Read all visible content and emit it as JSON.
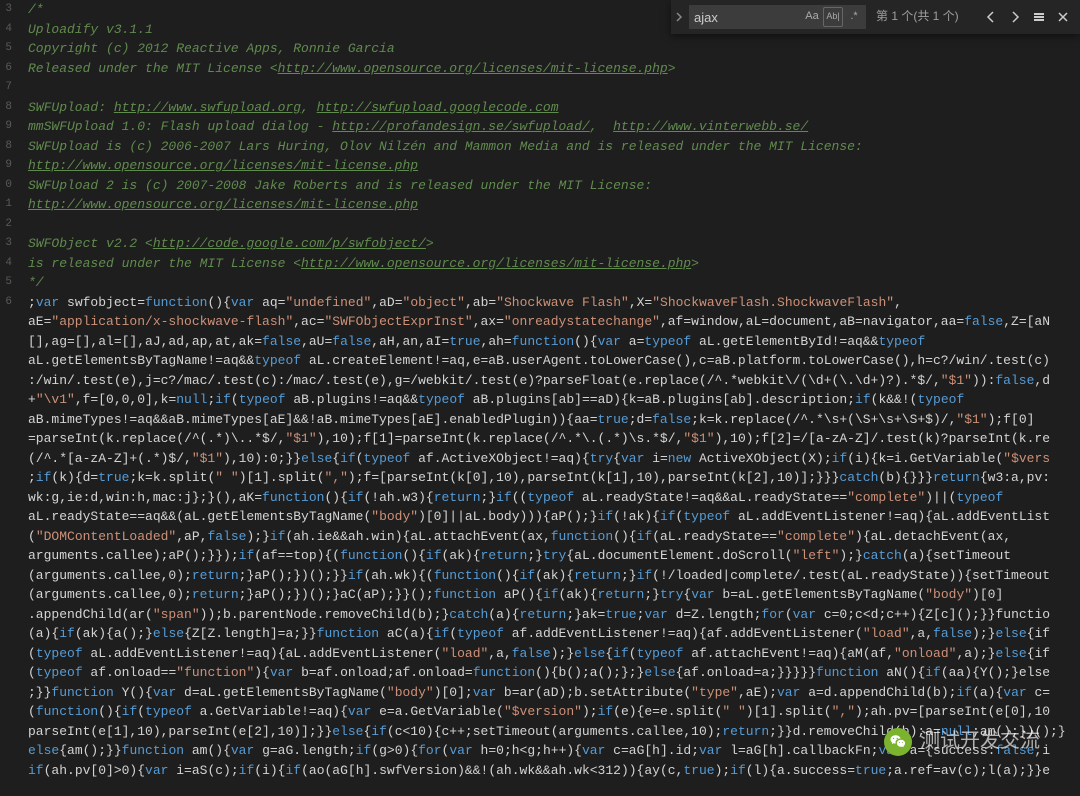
{
  "find_widget": {
    "input_value": "ajax",
    "match_case_label": "Aa",
    "whole_word_label": "Ab|",
    "regex_label": ".*",
    "result_count_text": "第 1 个(共 1 个)"
  },
  "watermark": {
    "text": "测试开发交流"
  },
  "code_lines": [
    {
      "n": "3",
      "t": "/*",
      "cls": "comment"
    },
    {
      "n": "4",
      "t": "Uploadify v3.1.1",
      "cls": "comment"
    },
    {
      "n": "5",
      "t": "Copyright (c) 2012 Reactive Apps, Ronnie Garcia",
      "cls": "comment"
    },
    {
      "n": "6",
      "html": "<span class='comment'>Released under the MIT License &lt;</span><span class='link'>http://www.opensource.org/licenses/mit-license.php</span><span class='comment'>&gt;</span>"
    },
    {
      "n": "7",
      "t": "",
      "cls": "comment"
    },
    {
      "n": "8",
      "html": "<span class='comment'>SWFUpload: </span><span class='link'>http://www.swfupload.org</span><span class='comment'>, </span><span class='link'>http://swfupload.googlecode.com</span>"
    },
    {
      "n": "9",
      "html": "<span class='comment'>mmSWFUpload 1.0: Flash upload dialog - </span><span class='link'>http://profandesign.se/swfupload/</span><span class='comment'>,  </span><span class='link'>http://www.vinterwebb.se/</span>"
    },
    {
      "n": "8",
      "t": "SWFUpload is (c) 2006-2007 Lars Huring, Olov Nilzén and Mammon Media and is released under the MIT License:",
      "cls": "comment"
    },
    {
      "n": "9",
      "html": "<span class='link'>http://www.opensource.org/licenses/mit-license.php</span>"
    },
    {
      "n": "0",
      "t": "SWFUpload 2 is (c) 2007-2008 Jake Roberts and is released under the MIT License:",
      "cls": "comment"
    },
    {
      "n": "1",
      "html": "<span class='link'>http://www.opensource.org/licenses/mit-license.php</span>"
    },
    {
      "n": "2",
      "t": "",
      "cls": "comment"
    },
    {
      "n": "3",
      "html": "<span class='comment'>SWFObject v2.2 &lt;</span><span class='link'>http://code.google.com/p/swfobject/</span><span class='comment'>&gt;</span>"
    },
    {
      "n": "4",
      "html": "<span class='comment'>is released under the MIT License &lt;</span><span class='link'>http://www.opensource.org/licenses/mit-license.php</span><span class='comment'>&gt;</span>"
    },
    {
      "n": "5",
      "t": "*/",
      "cls": "comment"
    },
    {
      "n": "6",
      "html": ";<span class='kw'>var</span> swfobject=<span class='kw'>function</span>(){<span class='kw'>var</span> aq=<span class='str'>\"undefined\"</span>,aD=<span class='str'>\"object\"</span>,ab=<span class='str'>\"Shockwave Flash\"</span>,X=<span class='str'>\"ShockwaveFlash.ShockwaveFlash\"</span>,"
    },
    {
      "n": "",
      "html": "aE=<span class='str'>\"application/x-shockwave-flash\"</span>,ac=<span class='str'>\"SWFObjectExprInst\"</span>,ax=<span class='str'>\"onreadystatechange\"</span>,af=window,aL=document,aB=navigator,aa=<span class='kw'>false</span>,Z=[aN"
    },
    {
      "n": "",
      "html": "[],ag=[],al=[],aJ,ad,ap,at,ak=<span class='kw'>false</span>,aU=<span class='kw'>false</span>,aH,an,aI=<span class='kw'>true</span>,ah=<span class='kw'>function</span>(){<span class='kw'>var</span> a=<span class='kw'>typeof</span> aL.getElementById!=aq&&<span class='kw'>typeof</span>"
    },
    {
      "n": "",
      "html": "aL.getElementsByTagName!=aq&&<span class='kw'>typeof</span> aL.createElement!=aq,e=aB.userAgent.toLowerCase(),c=aB.platform.toLowerCase(),h=c?/win/.test(c)"
    },
    {
      "n": "",
      "html": ":/win/.test(e),j=c?/mac/.test(c):/mac/.test(e),g=/webkit/.test(e)?parseFloat(e.replace(/^.*webkit\\/(\\d+(\\.\\d+)?).*$/,<span class='str'>\"$1\"</span>)):<span class='kw'>false</span>,d"
    },
    {
      "n": "",
      "html": "+<span class='str'>\"\\v1\"</span>,f=[0,0,0],k=<span class='kw'>null</span>;<span class='kw'>if</span>(<span class='kw'>typeof</span> aB.plugins!=aq&&<span class='kw'>typeof</span> aB.plugins[ab]==aD){k=aB.plugins[ab].description;<span class='kw'>if</span>(k&&!(<span class='kw'>typeof</span>"
    },
    {
      "n": "",
      "html": "aB.mimeTypes!=aq&&aB.mimeTypes[aE]&&!aB.mimeTypes[aE].enabledPlugin)){aa=<span class='kw'>true</span>;d=<span class='kw'>false</span>;k=k.replace(/^.*\\s+(\\S+\\s+\\S+$)/,<span class='str'>\"$1\"</span>);f[0]"
    },
    {
      "n": "",
      "html": "=parseInt(k.replace(/^(.*)\\..*$/,<span class='str'>\"$1\"</span>),10);f[1]=parseInt(k.replace(/^.*\\.(.*)\\s.*$/,<span class='str'>\"$1\"</span>),10);f[2]=/[a-zA-Z]/.test(k)?parseInt(k.re"
    },
    {
      "n": "",
      "html": "(/^.*[a-zA-Z]+(.*)$/,<span class='str'>\"$1\"</span>),10):0;}}<span class='kw'>else</span>{<span class='kw'>if</span>(<span class='kw'>typeof</span> af.ActiveXObject!=aq){<span class='kw'>try</span>{<span class='kw'>var</span> i=<span class='kw'>new</span> ActiveXObject(X);<span class='kw'>if</span>(i){k=i.GetVariable(<span class='str'>\"$vers"
    },
    {
      "n": "",
      "html": ";<span class='kw'>if</span>(k){d=<span class='kw'>true</span>;k=k.split(<span class='str'>\" \"</span>)[1].split(<span class='str'>\",\"</span>);f=[parseInt(k[0],10),parseInt(k[1],10),parseInt(k[2],10)];}}}<span class='kw'>catch</span>(b){}}}<span class='kw'>return</span>{w3:a,pv:"
    },
    {
      "n": "",
      "html": "wk:g,ie:d,win:h,mac:j};}(),aK=<span class='kw'>function</span>(){<span class='kw'>if</span>(!ah.w3){<span class='kw'>return</span>;}<span class='kw'>if</span>((<span class='kw'>typeof</span> aL.readyState!=aq&&aL.readyState==<span class='str'>\"complete\"</span>)||(<span class='kw'>typeof</span>"
    },
    {
      "n": "",
      "html": "aL.readyState==aq&&(aL.getElementsByTagName(<span class='str'>\"body\"</span>)[0]||aL.body))){aP();}<span class='kw'>if</span>(!ak){<span class='kw'>if</span>(<span class='kw'>typeof</span> aL.addEventListener!=aq){aL.addEventList"
    },
    {
      "n": "",
      "html": "(<span class='str'>\"DOMContentLoaded\"</span>,aP,<span class='kw'>false</span>);}<span class='kw'>if</span>(ah.ie&&ah.win){aL.attachEvent(ax,<span class='kw'>function</span>(){<span class='kw'>if</span>(aL.readyState==<span class='str'>\"complete\"</span>){aL.detachEvent(ax,"
    },
    {
      "n": "",
      "html": "arguments.callee);aP();}});<span class='kw'>if</span>(af==top){(<span class='kw'>function</span>(){<span class='kw'>if</span>(ak){<span class='kw'>return</span>;}<span class='kw'>try</span>{aL.documentElement.doScroll(<span class='str'>\"left\"</span>);}<span class='kw'>catch</span>(a){setTimeout"
    },
    {
      "n": "",
      "html": "(arguments.callee,0);<span class='kw'>return</span>;}aP();})();}}<span class='kw'>if</span>(ah.wk){(<span class='kw'>function</span>(){<span class='kw'>if</span>(ak){<span class='kw'>return</span>;}<span class='kw'>if</span>(!/loaded|complete/.test(aL.readyState)){setTimeout"
    },
    {
      "n": "",
      "html": "(arguments.callee,0);<span class='kw'>return</span>;}aP();})();}aC(aP);}}();<span class='kw'>function</span> aP(){<span class='kw'>if</span>(ak){<span class='kw'>return</span>;}<span class='kw'>try</span>{<span class='kw'>var</span> b=aL.getElementsByTagName(<span class='str'>\"body\"</span>)[0]"
    },
    {
      "n": "",
      "html": ".appendChild(ar(<span class='str'>\"span\"</span>));b.parentNode.removeChild(b);}<span class='kw'>catch</span>(a){<span class='kw'>return</span>;}ak=<span class='kw'>true</span>;<span class='kw'>var</span> d=Z.length;<span class='kw'>for</span>(<span class='kw'>var</span> c=0;c&lt;d;c++){Z[c]();}}functio"
    },
    {
      "n": "",
      "html": "(a){<span class='kw'>if</span>(ak){a();}<span class='kw'>else</span>{Z[Z.length]=a;}}<span class='kw'>function</span> aC(a){<span class='kw'>if</span>(<span class='kw'>typeof</span> af.addEventListener!=aq){af.addEventListener(<span class='str'>\"load\"</span>,a,<span class='kw'>false</span>);}<span class='kw'>else</span>{if"
    },
    {
      "n": "",
      "html": "(<span class='kw'>typeof</span> aL.addEventListener!=aq){aL.addEventListener(<span class='str'>\"load\"</span>,a,<span class='kw'>false</span>);}<span class='kw'>else</span>{<span class='kw'>if</span>(<span class='kw'>typeof</span> af.attachEvent!=aq){aM(af,<span class='str'>\"onload\"</span>,a);}<span class='kw'>else</span>{if"
    },
    {
      "n": "",
      "html": "(<span class='kw'>typeof</span> af.onload==<span class='str'>\"function\"</span>){<span class='kw'>var</span> b=af.onload;af.onload=<span class='kw'>function</span>(){b();a();};}<span class='kw'>else</span>{af.onload=a;}}}}}<span class='kw'>function</span> aN(){<span class='kw'>if</span>(aa){Y();}else"
    },
    {
      "n": "",
      "html": ";}}<span class='kw'>function</span> Y(){<span class='kw'>var</span> d=aL.getElementsByTagName(<span class='str'>\"body\"</span>)[0];<span class='kw'>var</span> b=ar(aD);b.setAttribute(<span class='str'>\"type\"</span>,aE);<span class='kw'>var</span> a=d.appendChild(b);<span class='kw'>if</span>(a){<span class='kw'>var</span> c="
    },
    {
      "n": "",
      "html": "(<span class='kw'>function</span>(){<span class='kw'>if</span>(<span class='kw'>typeof</span> a.GetVariable!=aq){<span class='kw'>var</span> e=a.GetVariable(<span class='str'>\"$version\"</span>);<span class='kw'>if</span>(e){e=e.split(<span class='str'>\" \"</span>)[1].split(<span class='str'>\",\"</span>);ah.pv=[parseInt(e[0],10"
    },
    {
      "n": "",
      "html": "parseInt(e[1],10),parseInt(e[2],10)];}}<span class='kw'>else</span>{<span class='kw'>if</span>(c&lt;10){c++;setTimeout(arguments.callee,10);<span class='kw'>return</span>;}}d.removeChild(b);a=<span class='kw'>null</span>;am();})();}"
    },
    {
      "n": "",
      "html": "<span class='kw'>else</span>{am();}}<span class='kw'>function</span> am(){<span class='kw'>var</span> g=aG.length;<span class='kw'>if</span>(g&gt;0){<span class='kw'>for</span>(<span class='kw'>var</span> h=0;h&lt;g;h++){<span class='kw'>var</span> c=aG[h].id;<span class='kw'>var</span> l=aG[h].callbackFn;<span class='kw'>var</span> a={success:<span class='kw'>false</span>,i"
    },
    {
      "n": "",
      "html": "<span class='kw'>if</span>(ah.pv[0]&gt;0){<span class='kw'>var</span> i=aS(c);<span class='kw'>if</span>(i){<span class='kw'>if</span>(ao(aG[h].swfVersion)&&!(ah.wk&&ah.wk&lt;312)){ay(c,<span class='kw'>true</span>);<span class='kw'>if</span>(l){a.success=<span class='kw'>true</span>;a.ref=av(c);l(a);}}e"
    }
  ]
}
